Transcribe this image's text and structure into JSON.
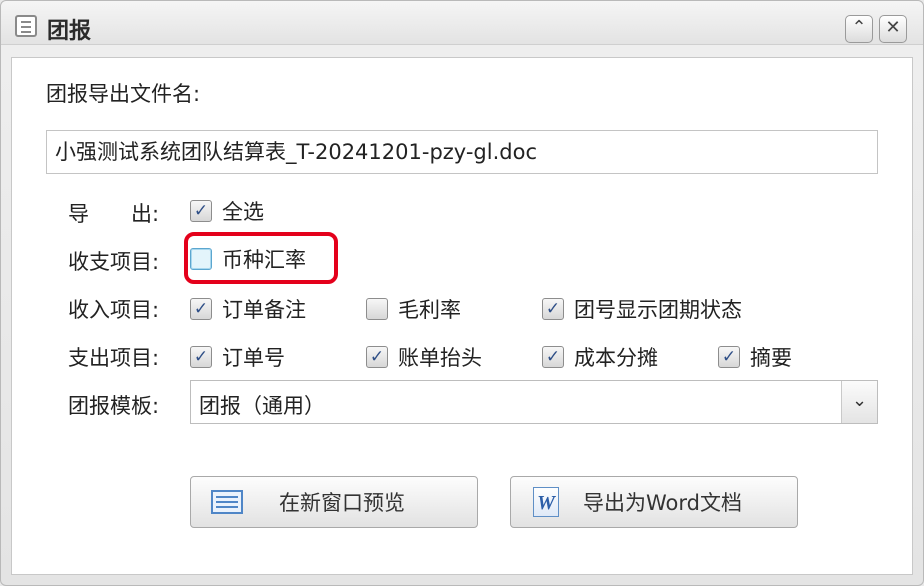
{
  "window": {
    "title": "团报",
    "collapse_glyph": "⌃",
    "close_glyph": "✕"
  },
  "form": {
    "filename_label": "团报导出文件名:",
    "filename_value": "小强测试系统团队结算表_T-20241201-pzy-gl.doc",
    "export": {
      "label": "导　　出:",
      "options": [
        {
          "label": "全选",
          "checked": true
        }
      ]
    },
    "income_expense": {
      "label": "收支项目:",
      "options": [
        {
          "label": "币种汇率",
          "checked": false,
          "highlighted": true
        }
      ]
    },
    "income_items": {
      "label": "收入项目:",
      "options": [
        {
          "label": "订单备注",
          "checked": true
        },
        {
          "label": "毛利率",
          "checked": false
        },
        {
          "label": "团号显示团期状态",
          "checked": true
        }
      ]
    },
    "expense_items": {
      "label": "支出项目:",
      "options": [
        {
          "label": "订单号",
          "checked": true
        },
        {
          "label": "账单抬头",
          "checked": true
        },
        {
          "label": "成本分摊",
          "checked": true
        },
        {
          "label": "摘要",
          "checked": true
        }
      ]
    },
    "template": {
      "label": "团报模板:",
      "selected": "团报（通用）"
    }
  },
  "buttons": {
    "preview_label": "在新窗口预览",
    "export_word_label": "导出为Word文档",
    "word_icon_glyph": "W"
  },
  "check_glyph": "✓",
  "colors": {
    "highlight_border": "#e4001b",
    "checkmark": "#2f4f87",
    "icon_blue": "#4f86c7"
  }
}
